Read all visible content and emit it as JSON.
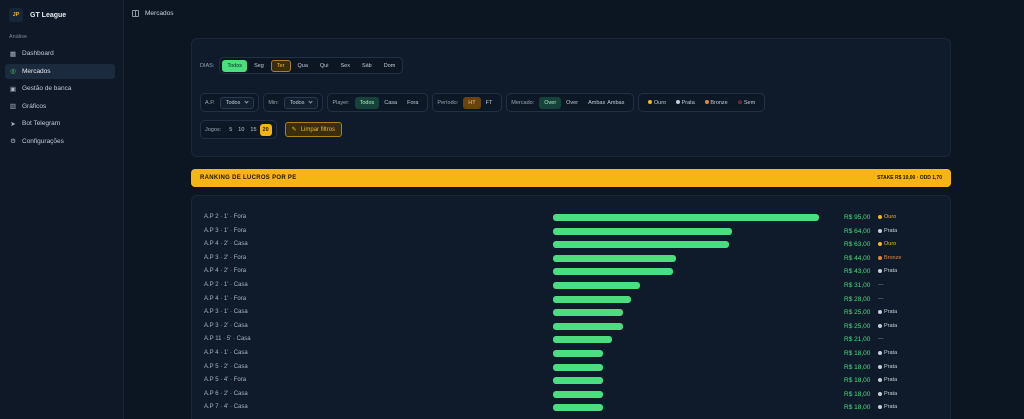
{
  "brand": {
    "logo": "JP",
    "name": "GT League"
  },
  "sidebar": {
    "section": "Análise",
    "items": [
      {
        "label": "Dashboard",
        "icon": "grid-icon",
        "glyph": "▦",
        "active": false
      },
      {
        "label": "Mercados",
        "icon": "target-icon",
        "glyph": "◎",
        "active": true
      },
      {
        "label": "Gestão de banca",
        "icon": "wallet-icon",
        "glyph": "▣",
        "active": false
      },
      {
        "label": "Gráficos",
        "icon": "bar-chart-icon",
        "glyph": "▥",
        "active": false
      },
      {
        "label": "Bot Telegram",
        "icon": "send-icon",
        "glyph": "➤",
        "active": false
      },
      {
        "label": "Configurações",
        "icon": "gear-icon",
        "glyph": "⚙",
        "active": false
      }
    ]
  },
  "topbar": {
    "title": "Mercados"
  },
  "filters": {
    "dias": {
      "label": "DIAS:",
      "options": [
        "Todos",
        "Seg",
        "Ter",
        "Qua",
        "Qui",
        "Sex",
        "Sáb",
        "Dom"
      ]
    },
    "ap": {
      "label": "A.P.",
      "value": "Todos"
    },
    "min": {
      "label": "Min:",
      "value": "Todos"
    },
    "player": {
      "label": "Player:",
      "options": [
        "Todos",
        "Casa",
        "Fora"
      ]
    },
    "periodo": {
      "label": "Período:",
      "options": [
        "HT",
        "FT"
      ]
    },
    "mercado": {
      "label": "Mercado:",
      "options": [
        "Over",
        "Over",
        "Ambas",
        "Ambas"
      ]
    },
    "medals": {
      "options": [
        "Ouro",
        "Prata",
        "Bronze",
        "Sem"
      ]
    },
    "jogos": {
      "label": "Jogos:",
      "options": [
        "5",
        "10",
        "15",
        "20"
      ]
    },
    "clear_label": "Limpar filtros"
  },
  "ranking": {
    "title": "RANKING DE LUCROS POR PE",
    "stake": "STAKE R$ 10,00 · ODD 1,70",
    "max_value": 95,
    "rows": [
      {
        "label": "A.P 2 · 1' · Fora",
        "value": 95,
        "value_text": "R$ 95,00",
        "medal": "Ouro"
      },
      {
        "label": "A.P 3 · 1' · Fora",
        "value": 64,
        "value_text": "R$ 64,00",
        "medal": "Prata"
      },
      {
        "label": "A.P 4 · 2' · Casa",
        "value": 63,
        "value_text": "R$ 63,00",
        "medal": "Ouro"
      },
      {
        "label": "A.P 3 · 2' · Fora",
        "value": 44,
        "value_text": "R$ 44,00",
        "medal": "Bronze"
      },
      {
        "label": "A.P 4 · 2' · Fora",
        "value": 43,
        "value_text": "R$ 43,00",
        "medal": "Prata"
      },
      {
        "label": "A.P 2 · 1' · Casa",
        "value": 31,
        "value_text": "R$ 31,00",
        "medal": "—"
      },
      {
        "label": "A.P 4 · 1' · Fora",
        "value": 28,
        "value_text": "R$ 28,00",
        "medal": "—"
      },
      {
        "label": "A.P 3 · 1' · Casa",
        "value": 25,
        "value_text": "R$ 25,00",
        "medal": "Prata"
      },
      {
        "label": "A.P 3 · 2' · Casa",
        "value": 25,
        "value_text": "R$ 25,00",
        "medal": "Prata"
      },
      {
        "label": "A.P 11 · 5' · Casa",
        "value": 21,
        "value_text": "R$ 21,00",
        "medal": "—"
      },
      {
        "label": "A.P 4 · 1' · Casa",
        "value": 18,
        "value_text": "R$ 18,00",
        "medal": "Prata"
      },
      {
        "label": "A.P 5 · 2' · Casa",
        "value": 18,
        "value_text": "R$ 18,00",
        "medal": "Prata"
      },
      {
        "label": "A.P 5 · 4' · Fora",
        "value": 18,
        "value_text": "R$ 18,00",
        "medal": "Prata"
      },
      {
        "label": "A.P 6 · 2' · Casa",
        "value": 18,
        "value_text": "R$ 18,00",
        "medal": "Prata"
      },
      {
        "label": "A.P 7 · 4' · Casa",
        "value": 18,
        "value_text": "R$ 18,00",
        "medal": "Prata"
      }
    ]
  },
  "colors": {
    "accent_green": "#4ade80",
    "accent_gold": "#f5b513",
    "gold": "#f0b724",
    "silver": "#c5ccd6",
    "bronze": "#e08a3c"
  }
}
